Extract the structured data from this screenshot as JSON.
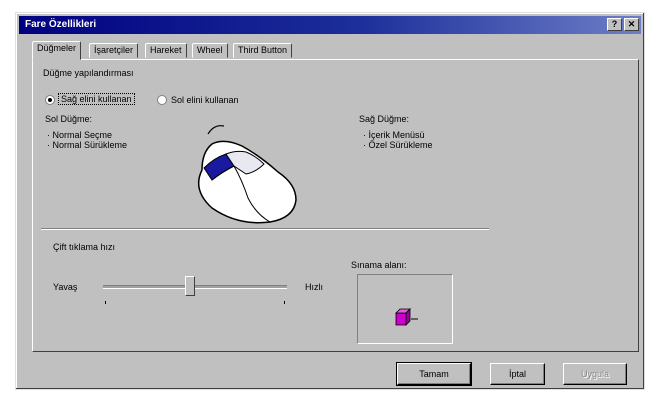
{
  "window": {
    "title": "Fare Özellikleri",
    "help_label": "?",
    "close_label": "✕"
  },
  "tabs": [
    {
      "label": "Düğmeler",
      "active": true
    },
    {
      "label": "İşaretçiler"
    },
    {
      "label": "Hareket"
    },
    {
      "label": "Wheel"
    },
    {
      "label": "Third Button"
    }
  ],
  "button_config": {
    "title": "Düğme yapılandırması",
    "option_left": "Sağ elini kullanan",
    "option_right": "Sol elini kullanan",
    "left_button": {
      "title": "Sol Düğme:",
      "items": [
        "· Normal Seçme",
        "· Normal Sürükleme"
      ]
    },
    "right_button": {
      "title": "Sağ Düğme:",
      "items": [
        "· İçerik Menüsü",
        "· Özel Sürükleme"
      ]
    }
  },
  "double_click": {
    "title": "Çift tıklama hızı",
    "slow_label": "Yavaş",
    "fast_label": "Hızlı",
    "speed_fraction": 0.47,
    "test_area_label": "Sınama alanı:"
  },
  "footer": {
    "ok_label": "Tamam",
    "cancel_label": "İptal",
    "apply_label": "Uygula"
  },
  "colors": {
    "title_bar": "#000080",
    "mouse_highlight": "#1a1aa0",
    "test_box": "#cc00cc"
  }
}
